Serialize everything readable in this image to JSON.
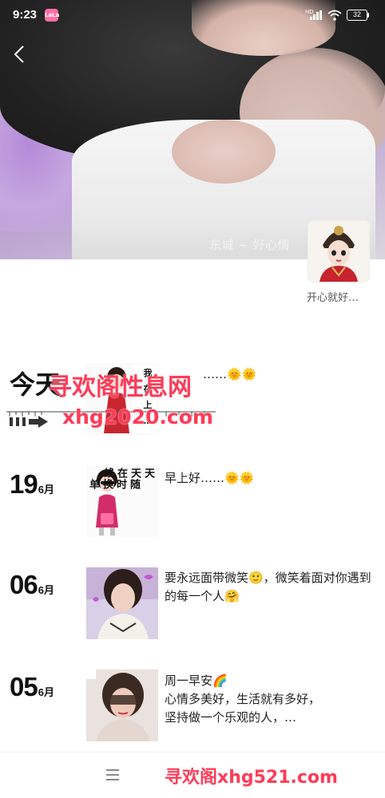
{
  "status_bar": {
    "time": "9:23",
    "app_badge": "LaLa",
    "network": "HD",
    "battery": "32"
  },
  "cover": {
    "caption": "东城 ~ 好心情"
  },
  "profile": {
    "name": "开心就好…"
  },
  "watermarks": {
    "top_text": "寻欢阁性息网",
    "top_url": "xhg2020.com",
    "bottom_text": "寻欢阁xhg521.com"
  },
  "feed": {
    "today": {
      "label": "今天",
      "thumb_lines": [
        "我",
        "在",
        "上",
        "…"
      ],
      "text": "……🌞🌞"
    },
    "posts": [
      {
        "day": "19",
        "month": "6月",
        "text": "早上好……🌞🌞",
        "thumb_lines": [
          "天天在线",
          "随时换单"
        ]
      },
      {
        "day": "06",
        "month": "6月",
        "text": "要永远面带微笑🙂，微笑着面对你遇到的每一个人🤗"
      },
      {
        "day": "05",
        "month": "6月",
        "text": "周一早安🌈\n心情多美好，生活就有多好，\n坚持做一个乐观的人，…"
      }
    ]
  },
  "colors": {
    "watermark": "#ff3b57",
    "accent_sun": "#f6a623"
  }
}
